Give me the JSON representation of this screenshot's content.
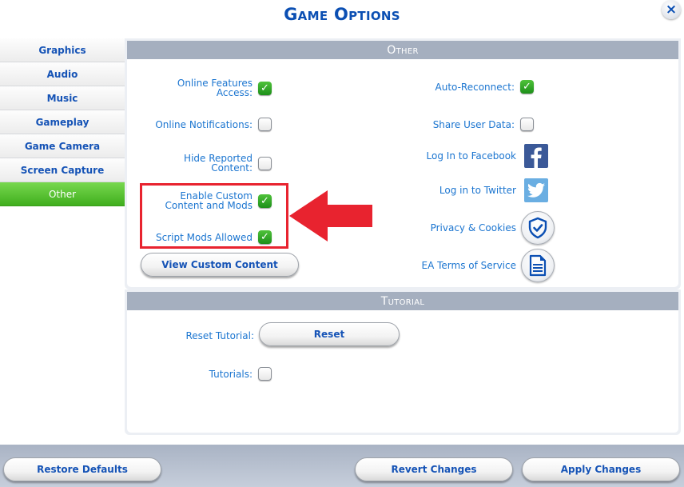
{
  "window": {
    "title": "Game Options",
    "close_label": "×"
  },
  "sidebar": {
    "items": [
      {
        "label": "Graphics",
        "active": false
      },
      {
        "label": "Audio",
        "active": false
      },
      {
        "label": "Music",
        "active": false
      },
      {
        "label": "Gameplay",
        "active": false
      },
      {
        "label": "Game Camera",
        "active": false
      },
      {
        "label": "Screen Capture",
        "active": false
      },
      {
        "label": "Other",
        "active": true
      }
    ]
  },
  "other": {
    "header": "Other",
    "left": {
      "online_features": {
        "label_line1": "Online Features",
        "label_line2": "Access:",
        "checked": true
      },
      "online_notifications": {
        "label": "Online Notifications:",
        "checked": false
      },
      "hide_reported": {
        "label_line1": "Hide Reported",
        "label_line2": "Content:",
        "checked": false
      },
      "custom_content": {
        "label_line1": "Enable Custom",
        "label_line2": "Content and Mods",
        "checked": true
      },
      "script_mods": {
        "label": "Script Mods Allowed",
        "checked": true
      },
      "view_custom_content_label": "View Custom Content"
    },
    "right": {
      "auto_reconnect": {
        "label": "Auto-Reconnect:",
        "checked": true
      },
      "share_user_data": {
        "label": "Share User Data:",
        "checked": false
      },
      "facebook": {
        "label": "Log In to Facebook",
        "icon": "facebook-icon",
        "color": "#3b5998"
      },
      "twitter": {
        "label": "Log in to Twitter",
        "icon": "twitter-icon",
        "color": "#6aaee2"
      },
      "privacy": {
        "label": "Privacy & Cookies",
        "icon": "shield-check-icon"
      },
      "terms": {
        "label": "EA Terms of Service",
        "icon": "document-icon"
      }
    }
  },
  "tutorial": {
    "header": "Tutorial",
    "reset_label": "Reset Tutorial:",
    "reset_button": "Reset",
    "tutorials": {
      "label": "Tutorials:",
      "checked": false
    }
  },
  "footer": {
    "restore_defaults": "Restore Defaults",
    "revert_changes": "Revert Changes",
    "apply_changes": "Apply Changes"
  },
  "annotation": {
    "color": "#e8232f"
  },
  "check_glyph": "✓"
}
